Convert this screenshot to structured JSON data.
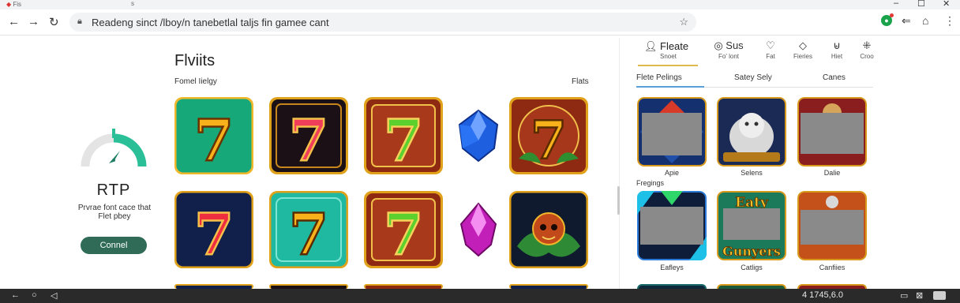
{
  "browser": {
    "tab_left": "Fis",
    "tab_right": "s",
    "url": "Readeng sinct /lboy/n tanebetlal taljs fin gamee cant",
    "window_controls": [
      "–",
      "☐",
      "✕"
    ]
  },
  "left_panel": {
    "rtp_label": "RTP",
    "rtp_text": "Prvrae font cace that Flet pbey",
    "connect_label": "Connel"
  },
  "main": {
    "title": "Flviits",
    "subtitle_left": "Fomel Iielgy",
    "subtitle_right": "Flats"
  },
  "right_panel": {
    "tabs": [
      {
        "main": "Fleate",
        "label": "Snoet",
        "icon": "user-icon"
      },
      {
        "main": "Sus",
        "label": "Fo' lont",
        "icon": "coin-icon"
      },
      {
        "main": "",
        "label": "Fat",
        "icon": "heart-icon"
      },
      {
        "main": "",
        "label": "Fieries",
        "icon": "gem-icon"
      },
      {
        "main": "",
        "label": "Hiet",
        "icon": "cup-icon"
      },
      {
        "main": "",
        "label": "Croo",
        "icon": "grid-icon"
      }
    ],
    "categories": [
      "Flete Pelings",
      "Satey Sely",
      "Canes"
    ],
    "row_label": "Fregings",
    "cards": [
      {
        "label": "Apie"
      },
      {
        "label": "Selens"
      },
      {
        "label": "Dalie"
      },
      {
        "label": "Eafleys"
      },
      {
        "label": "Catligs",
        "art_text_top": "Eaty",
        "art_text_bottom": "Gunyers"
      },
      {
        "label": "Canfiies"
      }
    ]
  },
  "taskbar": {
    "clock": "4 1745,6.0",
    "left_icons": [
      "back-icon",
      "home-icon",
      "send-icon"
    ]
  },
  "colors": {
    "connect_button": "#2f6b57",
    "gauge_green": "#2bbf97",
    "tile_gold": "#e0a21a",
    "taskbar": "#2a2a2a"
  }
}
